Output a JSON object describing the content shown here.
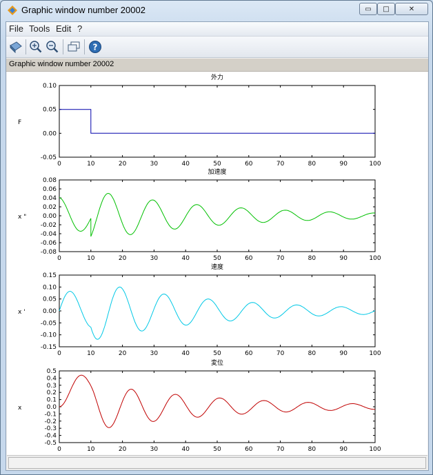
{
  "window": {
    "title": "Graphic window number 20002",
    "min_label": "▭",
    "max_label": "□",
    "close_label": "✕"
  },
  "menu": [
    {
      "label": "File"
    },
    {
      "label": "Tools"
    },
    {
      "label": "Edit"
    },
    {
      "label": "?"
    }
  ],
  "toolbar": {
    "icons": [
      "rotate-icon",
      "zoom-in-icon",
      "zoom-out-icon",
      "datatip-icon",
      "help-icon"
    ]
  },
  "infobar": {
    "text": "Graphic window number 20002"
  },
  "status": {
    "text": ""
  },
  "chart_data": [
    {
      "type": "line",
      "title": "外力",
      "ylabel": "F",
      "xlim": [
        0,
        100
      ],
      "ylim": [
        -0.05,
        0.1
      ],
      "xticks": [
        0,
        10,
        20,
        30,
        40,
        50,
        60,
        70,
        80,
        90,
        100
      ],
      "yticks": [
        -0.05,
        0.0,
        0.05,
        0.1
      ],
      "ytick_labels": [
        "-0.05",
        "0.00",
        "0.05",
        "0.10"
      ],
      "color": "#0000aa",
      "series": [
        {
          "kind": "step",
          "x": [
            0,
            10,
            10,
            100
          ],
          "y": [
            0.05,
            0.05,
            0.0,
            0.0
          ]
        }
      ]
    },
    {
      "type": "line",
      "title": "加速度",
      "ylabel": "x \"",
      "xlim": [
        0,
        100
      ],
      "ylim": [
        -0.08,
        0.08
      ],
      "xticks": [
        0,
        10,
        20,
        30,
        40,
        50,
        60,
        70,
        80,
        90,
        100
      ],
      "yticks": [
        -0.08,
        -0.06,
        -0.04,
        -0.02,
        0.0,
        0.02,
        0.04,
        0.06,
        0.08
      ],
      "ytick_labels": [
        "-0.08",
        "-0.06",
        "-0.04",
        "-0.02",
        "0.00",
        "0.02",
        "0.04",
        "0.06",
        "0.08"
      ],
      "color": "#00c000",
      "series": [
        {
          "kind": "response",
          "quantity": "acceleration"
        }
      ]
    },
    {
      "type": "line",
      "title": "速度",
      "ylabel": "x '",
      "xlim": [
        0,
        100
      ],
      "ylim": [
        -0.15,
        0.15
      ],
      "xticks": [
        0,
        10,
        20,
        30,
        40,
        50,
        60,
        70,
        80,
        90,
        100
      ],
      "yticks": [
        -0.15,
        -0.1,
        -0.05,
        0.0,
        0.05,
        0.1,
        0.15
      ],
      "ytick_labels": [
        "-0.15",
        "-0.10",
        "-0.05",
        "0.00",
        "0.05",
        "0.10",
        "0.15"
      ],
      "color": "#00c8e6",
      "series": [
        {
          "kind": "response",
          "quantity": "velocity"
        }
      ]
    },
    {
      "type": "line",
      "title": "変位",
      "ylabel": "x",
      "xlim": [
        0,
        100
      ],
      "ylim": [
        -0.5,
        0.5
      ],
      "xticks": [
        0,
        10,
        20,
        30,
        40,
        50,
        60,
        70,
        80,
        90,
        100
      ],
      "yticks": [
        -0.5,
        -0.4,
        -0.3,
        -0.2,
        -0.1,
        0.0,
        0.1,
        0.2,
        0.3,
        0.4,
        0.5
      ],
      "ytick_labels": [
        "-0.5",
        "-0.4",
        "-0.3",
        "-0.2",
        "-0.1",
        "0.0",
        "0.1",
        "0.2",
        "0.3",
        "0.4",
        "0.5"
      ],
      "color": "#c00000",
      "series": [
        {
          "kind": "response",
          "quantity": "displacement"
        }
      ]
    }
  ]
}
